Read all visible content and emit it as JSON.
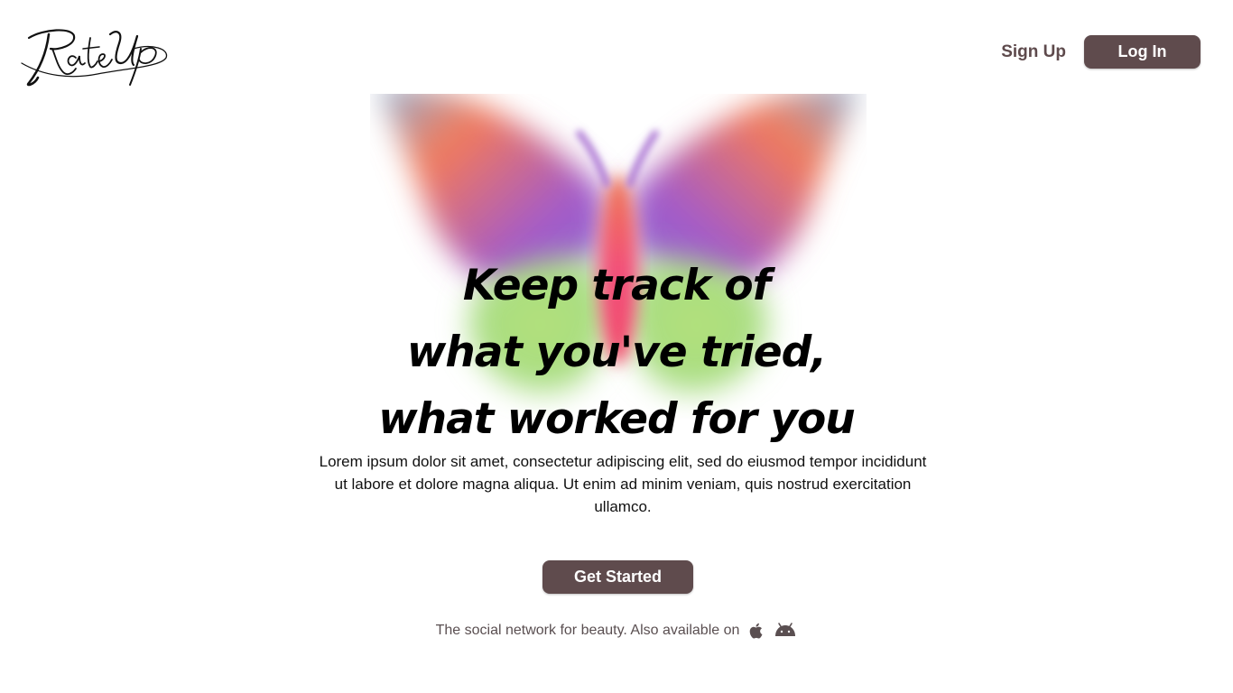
{
  "header": {
    "logo_text": "RateUp",
    "signup_label": "Sign Up",
    "login_label": "Log In"
  },
  "hero": {
    "headline_lines": [
      "Keep track of",
      "what you've tried,",
      "what worked for you"
    ],
    "description": "Lorem ipsum dolor sit amet, consectetur adipiscing elit, sed do eiusmod tempor incididunt ut labore et dolore magna aliqua. Ut enim ad minim veniam, quis nostrud exercitation ullamco.",
    "cta_label": "Get Started"
  },
  "footer": {
    "tagline": "The social network for beauty. Also available on",
    "platforms": [
      {
        "icon": "apple-icon"
      },
      {
        "icon": "android-icon"
      }
    ]
  },
  "colors": {
    "button_bg": "#5f4b4d",
    "button_text": "#ffffff",
    "nav_link": "#5e4a4c",
    "headline": "#000000",
    "wing_orange": "#f07a5e",
    "wing_purple": "#a05ec8",
    "wing_green": "#a8e07a",
    "wing_blue": "#8eb2d8",
    "body_pink": "#f44a7a"
  }
}
